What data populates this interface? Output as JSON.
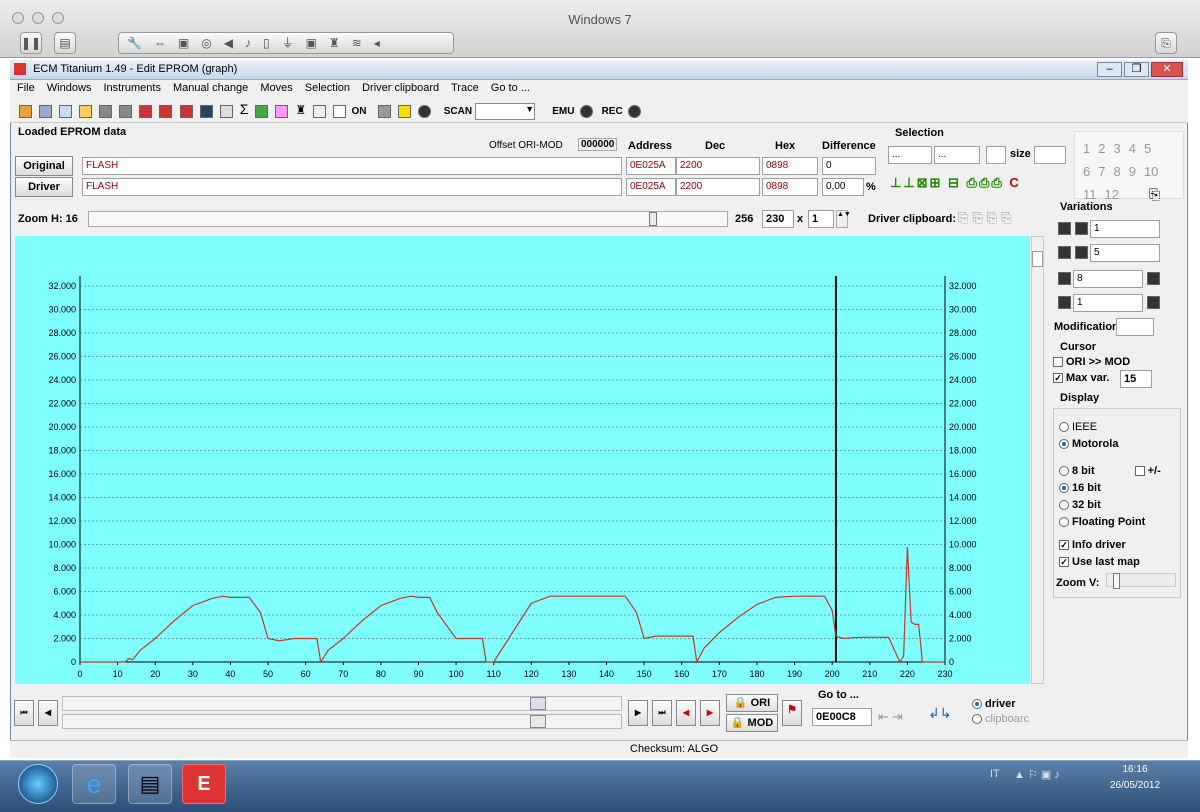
{
  "mac": {
    "title": "Windows 7"
  },
  "app": {
    "title": "ECM Titanium 1.49 - Edit EPROM (graph)"
  },
  "menu": [
    "File",
    "Windows",
    "Instruments",
    "Manual change",
    "Moves",
    "Selection",
    "Driver clipboard",
    "Trace",
    "Go to ..."
  ],
  "toolbar": {
    "on_label": "ON",
    "scan_label": "SCAN",
    "emu_label": "EMU",
    "rec_label": "REC"
  },
  "eprom": {
    "header": "Loaded EPROM data",
    "offset_label": "Offset ORI-MOD",
    "offset_value": "000000",
    "col_address": "Address",
    "col_dec": "Dec",
    "col_hex": "Hex",
    "col_diff": "Difference",
    "original_label": "Original",
    "original_name": "FLASH",
    "original_address": "0E025A",
    "original_dec": "2200",
    "original_hex": "0898",
    "original_diff": "0",
    "driver_label": "Driver",
    "driver_name": "FLASH",
    "driver_address": "0E025A",
    "driver_dec": "2200",
    "driver_hex": "0898",
    "driver_diff": "0,00",
    "pct": "%"
  },
  "selection": {
    "title": "Selection",
    "from": "...",
    "to": "...",
    "size_label": "size"
  },
  "pages": [
    "1",
    "2",
    "3",
    "4",
    "5",
    "6",
    "7",
    "8",
    "9",
    "10",
    "11",
    "12"
  ],
  "zoom": {
    "label": "Zoom H: 16",
    "max": "256",
    "value": "230",
    "mult_x": "x",
    "mult": "1",
    "clipboard_label": "Driver clipboard:"
  },
  "variations": {
    "title": "Variations",
    "v1": "1",
    "v2": "5",
    "a": "8",
    "p": "1"
  },
  "modification": {
    "label": "Modification"
  },
  "cursor": {
    "title": "Cursor",
    "ori_mod": "ORI >> MOD",
    "max_var_label": "Max var.",
    "max_var_value": "15"
  },
  "display": {
    "title": "Display",
    "ieee": "IEEE",
    "motorola": "Motorola",
    "b8": "8 bit",
    "pm": "+/-",
    "b16": "16 bit",
    "b32": "32 bit",
    "fp": "Floating Point",
    "info_driver": "Info driver",
    "use_last_map": "Use last map",
    "zoom_v": "Zoom V:"
  },
  "goto": {
    "title": "Go to ...",
    "value": "0E00C8",
    "ori": "ORI",
    "mod": "MOD",
    "driver": "driver",
    "clipboard": "clipboarc"
  },
  "status": {
    "checksum": "Checksum: ALGO"
  },
  "taskbar": {
    "lang": "IT",
    "time": "16:16",
    "date": "26/05/2012"
  },
  "chart_data": {
    "type": "line",
    "ylim": [
      0,
      32000
    ],
    "xlim": [
      0,
      230
    ],
    "yticks": [
      "0",
      "2.000",
      "4.000",
      "6.000",
      "8.000",
      "10.000",
      "12.000",
      "14.000",
      "16.000",
      "18.000",
      "20.000",
      "22.000",
      "24.000",
      "26.000",
      "28.000",
      "30.000",
      "32.000"
    ],
    "xticks": [
      "0",
      "10",
      "20",
      "30",
      "40",
      "50",
      "60",
      "70",
      "80",
      "90",
      "100",
      "110",
      "120",
      "130",
      "140",
      "150",
      "160",
      "170",
      "180",
      "190",
      "200",
      "210",
      "220",
      "230"
    ],
    "cursor_x": 201,
    "x": [
      0,
      12,
      13,
      14,
      16,
      20,
      25,
      30,
      35,
      38,
      40,
      45,
      48,
      50,
      53,
      57,
      60,
      63,
      64,
      66,
      70,
      75,
      80,
      85,
      88,
      90,
      93,
      95,
      100,
      105,
      107,
      108,
      110,
      115,
      118,
      120,
      125,
      130,
      140,
      145,
      148,
      150,
      153,
      157,
      160,
      163,
      164,
      166,
      170,
      175,
      180,
      185,
      190,
      195,
      198,
      200,
      201,
      203,
      207,
      210,
      215,
      218,
      219,
      220,
      221,
      222,
      223,
      224,
      228,
      230
    ],
    "y": [
      0,
      0,
      300,
      200,
      1000,
      2000,
      3500,
      4800,
      5400,
      5600,
      5500,
      5500,
      4200,
      2000,
      1800,
      2000,
      2000,
      2000,
      0,
      1000,
      2000,
      3500,
      4800,
      5400,
      5600,
      5500,
      5500,
      4200,
      2000,
      2000,
      2000,
      0,
      0,
      2500,
      4000,
      5000,
      5600,
      5600,
      5600,
      5600,
      4200,
      2000,
      2200,
      2200,
      2200,
      2200,
      0,
      1200,
      2500,
      3800,
      4900,
      5500,
      5600,
      5600,
      5600,
      4400,
      2200,
      2000,
      2100,
      2100,
      2100,
      0,
      500,
      9800,
      3400,
      3200,
      3200,
      0,
      0,
      0
    ]
  }
}
